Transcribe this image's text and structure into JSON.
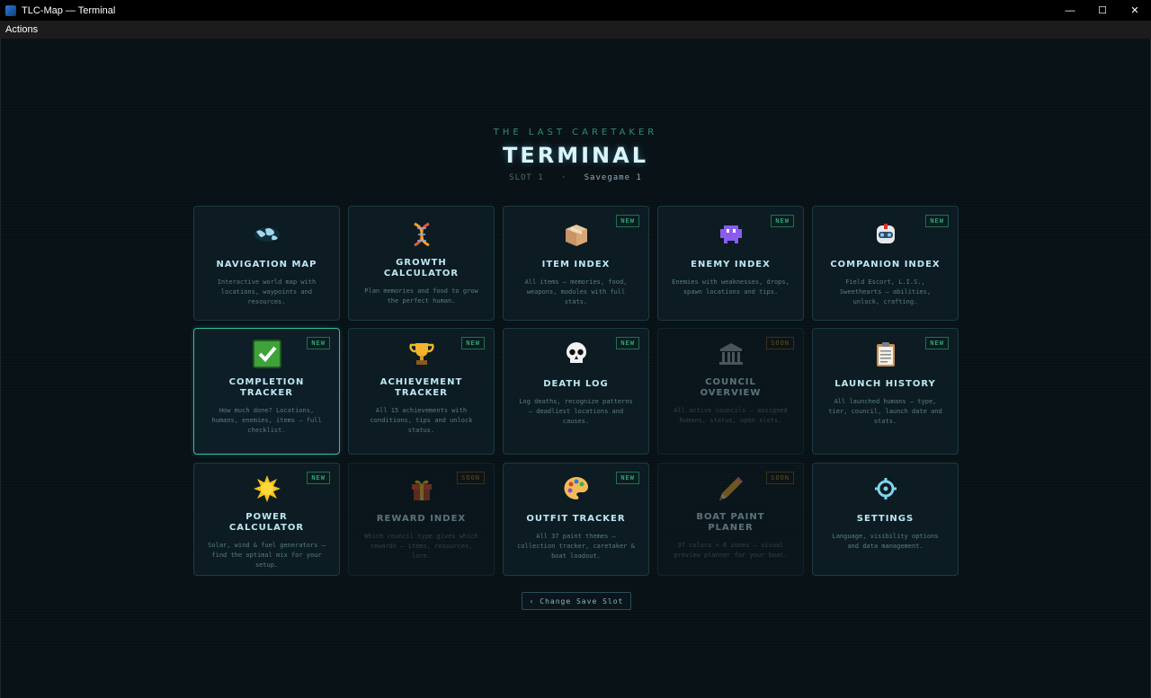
{
  "window": {
    "title": "TLC-Map — Terminal",
    "minimize": "—",
    "maximize": "☐",
    "close": "✕"
  },
  "menu": {
    "actions": "Actions"
  },
  "header": {
    "subtitle": "THE LAST CARETAKER",
    "title": "TERMINAL",
    "slot_label": "SLOT 1",
    "separator": "·",
    "save_name": "Savegame 1"
  },
  "cards": [
    {
      "title": "NAVIGATION MAP",
      "desc": "Interactive world map with locations, waypoints and resources.",
      "badge": "",
      "icon": "world-map-icon",
      "state": "normal"
    },
    {
      "title": "GROWTH CALCULATOR",
      "desc": "Plan memories and food to grow the perfect human.",
      "badge": "",
      "icon": "dna-icon",
      "state": "normal"
    },
    {
      "title": "ITEM INDEX",
      "desc": "All items — memories, food, weapons, modules with full stats.",
      "badge": "NEW",
      "icon": "box-icon",
      "state": "normal"
    },
    {
      "title": "ENEMY INDEX",
      "desc": "Enemies with weaknesses, drops, spawn locations and tips.",
      "badge": "NEW",
      "icon": "alien-monster-icon",
      "state": "normal"
    },
    {
      "title": "COMPANION INDEX",
      "desc": "Field Escort, L.I.S., Sweethearts — abilities, unlock, crafting.",
      "badge": "NEW",
      "icon": "robot-icon",
      "state": "normal"
    },
    {
      "title": "COMPLETION TRACKER",
      "desc": "How much done? Locations, humans, enemies, items — full checklist.",
      "badge": "NEW",
      "icon": "check-mark-icon",
      "state": "active"
    },
    {
      "title": "ACHIEVEMENT TRACKER",
      "desc": "All 15 achievements with conditions, tips and unlock status.",
      "badge": "NEW",
      "icon": "trophy-icon",
      "state": "normal"
    },
    {
      "title": "DEATH LOG",
      "desc": "Log deaths, recognize patterns — deadliest locations and causes.",
      "badge": "NEW",
      "icon": "skull-icon",
      "state": "normal"
    },
    {
      "title": "COUNCIL OVERVIEW",
      "desc": "All active councils — assigned humans, status, open slots.",
      "badge": "SOON",
      "icon": "classical-building-icon",
      "state": "disabled"
    },
    {
      "title": "LAUNCH HISTORY",
      "desc": "All launched humans — type, tier, council, launch date and stats.",
      "badge": "NEW",
      "icon": "clipboard-icon",
      "state": "normal"
    },
    {
      "title": "POWER CALCULATOR",
      "desc": "Solar, wind & fuel generators — find the optimal mix for your setup.",
      "badge": "NEW",
      "icon": "sun-icon",
      "state": "normal"
    },
    {
      "title": "REWARD INDEX",
      "desc": "Which council type gives which rewards — items, resources, lore.",
      "badge": "SOON",
      "icon": "gift-icon",
      "state": "disabled"
    },
    {
      "title": "OUTFIT TRACKER",
      "desc": "All 37 paint themes — collection tracker, caretaker & boat loadout.",
      "badge": "NEW",
      "icon": "palette-icon",
      "state": "normal"
    },
    {
      "title": "BOAT PAINT PLANER",
      "desc": "37 colors × 6 zones — visual preview planner for your boat.",
      "badge": "SOON",
      "icon": "pencil-icon",
      "state": "disabled"
    },
    {
      "title": "SETTINGS",
      "desc": "Language, visibility options and data management.",
      "badge": "",
      "icon": "gear-icon",
      "state": "normal"
    }
  ],
  "footer": {
    "change_slot": "‹ Change Save Slot"
  },
  "colors": {
    "accent": "#2fc1a4",
    "badge_new": "#3fc79f",
    "badge_soon": "#b99a48",
    "title": "#d9f6ff"
  }
}
